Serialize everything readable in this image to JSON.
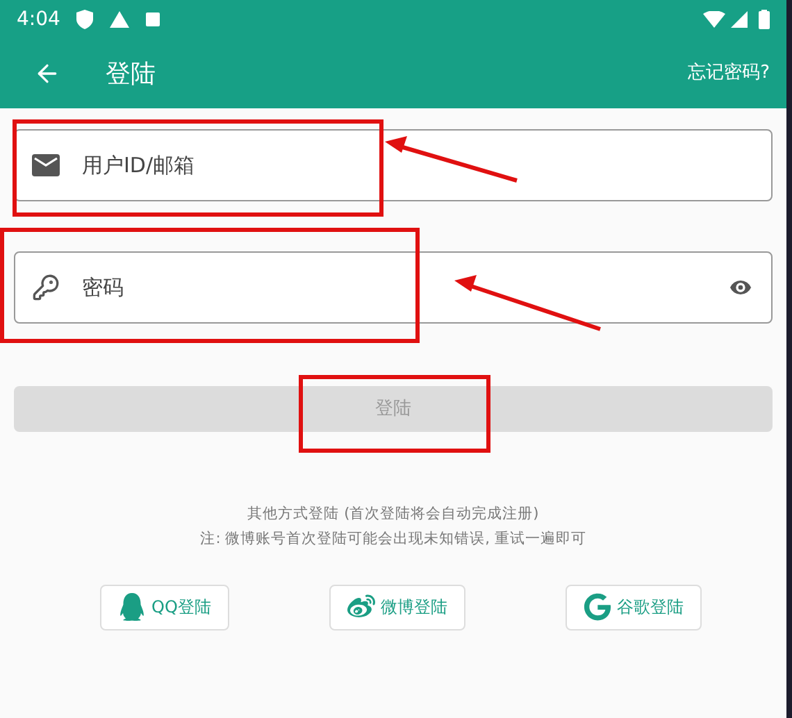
{
  "status_bar": {
    "time": "4:04"
  },
  "toolbar": {
    "title": "登陆",
    "action": "忘记密码?"
  },
  "fields": [
    {
      "kind": "email",
      "placeholder": "用户ID/邮箱"
    },
    {
      "kind": "password",
      "placeholder": "密码"
    }
  ],
  "login_button": {
    "label": "登陆",
    "disabled": true
  },
  "notes": [
    "其他方式登陆 (首次登陆将会自动完成注册)",
    "注: 微博账号首次登陆可能会出现未知错误, 重试一遍即可"
  ],
  "social_buttons": [
    {
      "kind": "qq",
      "label": "QQ登陆"
    },
    {
      "kind": "weibo",
      "label": "微博登陆"
    },
    {
      "kind": "google",
      "label": "谷歌登陆"
    }
  ]
}
